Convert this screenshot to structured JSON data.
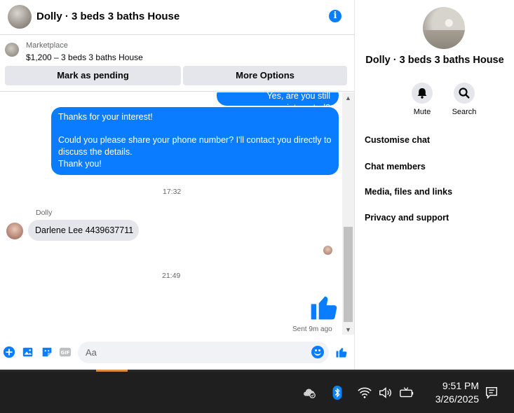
{
  "chat": {
    "title": "Dolly · 3 beds 3 baths House",
    "marketplace_label": "Marketplace",
    "listing": "$1,200 – 3 beds 3 baths House",
    "buttons": {
      "pending": "Mark as pending",
      "more": "More Options"
    },
    "messages": {
      "outgoing_top": "Yes, are you still interested?",
      "outgoing_main": {
        "line1": "Thanks for your interest!",
        "line2": "Could you please share your phone number? I'll contact you directly to discuss the details.",
        "line3": "Thank you!"
      },
      "timestamp1": "17:32",
      "sender": "Dolly",
      "incoming": "Darlene Lee 4439637711",
      "timestamp2": "21:49",
      "status": "Sent 9m ago"
    },
    "composer": {
      "placeholder": "Aa"
    }
  },
  "details": {
    "title": "Dolly · 3 beds 3 baths House",
    "actions": {
      "mute": "Mute",
      "search": "Search"
    },
    "menu": [
      "Customise chat",
      "Chat members",
      "Media, files and links",
      "Privacy and support"
    ]
  },
  "taskbar": {
    "time": "9:51 PM",
    "date": "3/26/2025"
  },
  "colors": {
    "accent": "#0a7cff",
    "bubble_in": "#e4e6eb",
    "taskbar": "#1f1f1f"
  }
}
